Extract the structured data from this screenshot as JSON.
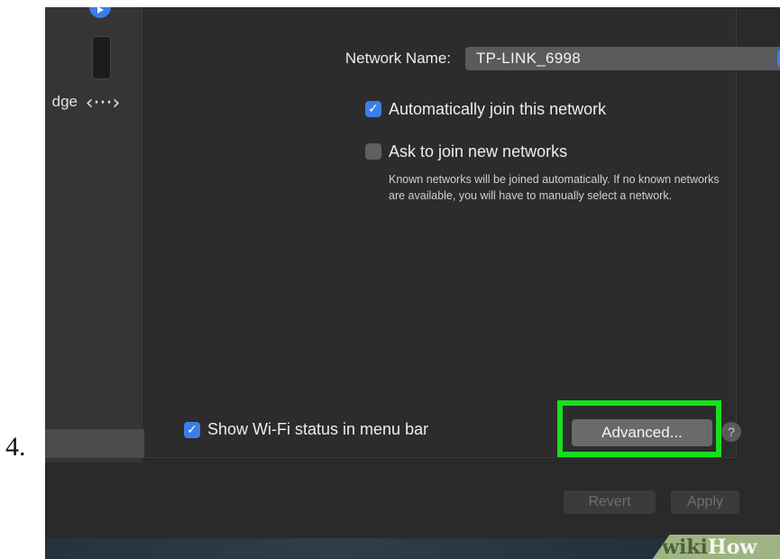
{
  "step_number": "4.",
  "sidebar": {
    "bridge_label": "dge",
    "bridge_icon": "‹···›"
  },
  "network": {
    "name_label": "Network Name:",
    "selected_network": "TP-LINK_6998"
  },
  "options": {
    "auto_join": {
      "label": "Automatically join this network",
      "checked": true
    },
    "ask_to_join": {
      "label": "Ask to join new networks",
      "checked": false,
      "help_text": "Known networks will be joined automatically. If no known networks are available, you will have to manually select a network."
    },
    "show_status": {
      "label": "Show Wi-Fi status in menu bar",
      "checked": true
    }
  },
  "buttons": {
    "advanced": "Advanced...",
    "help": "?",
    "revert": "Revert",
    "apply": "Apply"
  },
  "watermark": {
    "part1": "wiki",
    "part2": "How"
  },
  "colors": {
    "accent": "#3c7ee6",
    "highlight": "#18e01e",
    "panel_background": "#2c2c2d"
  },
  "icons": {
    "checkbox_check": "checkmark-icon",
    "popup_arrows": "up-down-chevron-icon",
    "bridge": "network-bridge-icon"
  }
}
